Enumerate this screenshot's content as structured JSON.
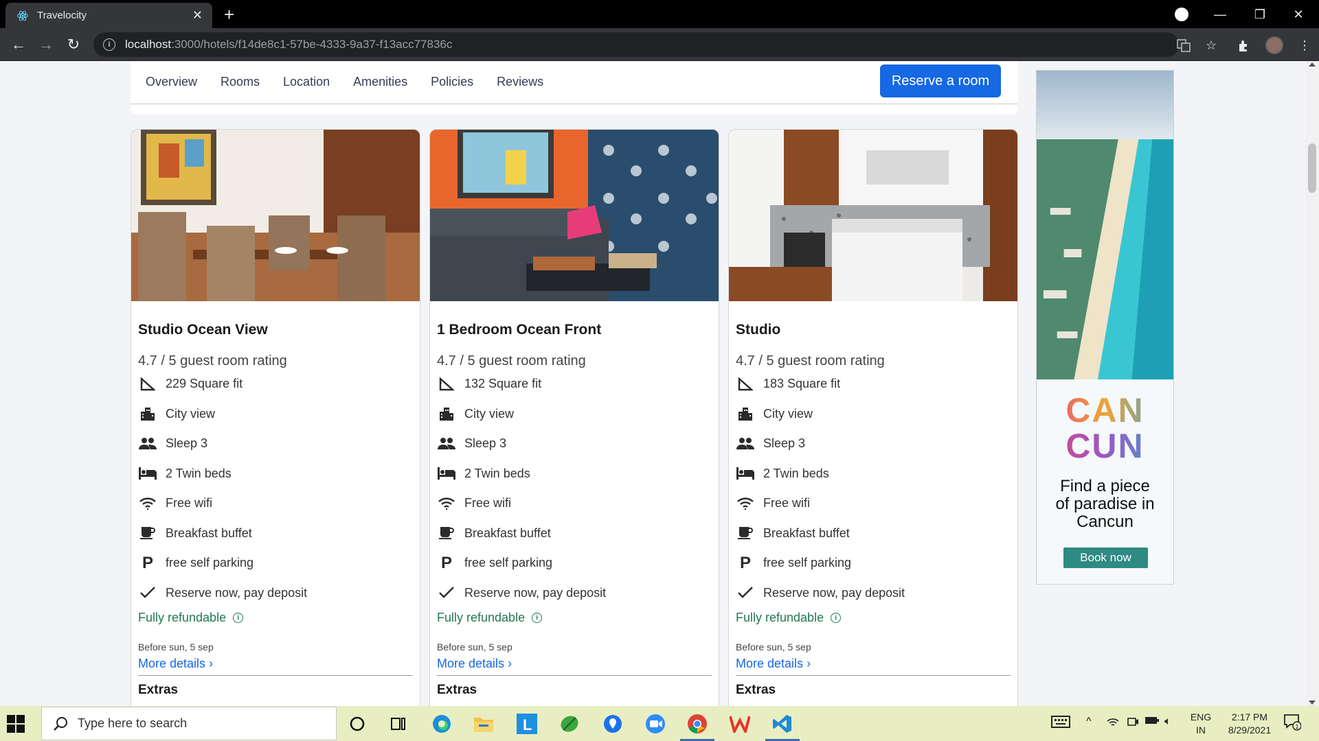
{
  "browser": {
    "tab_title": "Travelocity",
    "url_host": "localhost",
    "url_path": ":3000/hotels/f14de8c1-57be-4333-9a37-f13acc77836c"
  },
  "subnav": {
    "links": [
      "Overview",
      "Rooms",
      "Location",
      "Amenities",
      "Policies",
      "Reviews"
    ],
    "reserve_label": "Reserve a room"
  },
  "rooms": [
    {
      "name": "Studio Ocean View",
      "rating": "4.7 / 5 guest room rating",
      "features": [
        {
          "icon": "area-icon",
          "text": "229 Square fit"
        },
        {
          "icon": "city-icon",
          "text": "City view"
        },
        {
          "icon": "people-icon",
          "text": "Sleep 3"
        },
        {
          "icon": "bed-icon",
          "text": "2 Twin beds"
        },
        {
          "icon": "wifi-icon",
          "text": "Free wifi"
        },
        {
          "icon": "coffee-icon",
          "text": "Breakfast buffet"
        },
        {
          "icon": "parking-icon",
          "text": "free self parking"
        },
        {
          "icon": "check-icon",
          "text": "Reserve now, pay deposit"
        }
      ],
      "refund": "Fully refundable",
      "before": "Before sun, 5 sep",
      "more": "More details",
      "extras": "Extras"
    },
    {
      "name": "1 Bedroom Ocean Front",
      "rating": "4.7 / 5 guest room rating",
      "features": [
        {
          "icon": "area-icon",
          "text": "132 Square fit"
        },
        {
          "icon": "city-icon",
          "text": "City view"
        },
        {
          "icon": "people-icon",
          "text": "Sleep 3"
        },
        {
          "icon": "bed-icon",
          "text": "2 Twin beds"
        },
        {
          "icon": "wifi-icon",
          "text": "Free wifi"
        },
        {
          "icon": "coffee-icon",
          "text": "Breakfast buffet"
        },
        {
          "icon": "parking-icon",
          "text": "free self parking"
        },
        {
          "icon": "check-icon",
          "text": "Reserve now, pay deposit"
        }
      ],
      "refund": "Fully refundable",
      "before": "Before sun, 5 sep",
      "more": "More details",
      "extras": "Extras"
    },
    {
      "name": "Studio",
      "rating": "4.7 / 5 guest room rating",
      "features": [
        {
          "icon": "area-icon",
          "text": "183 Square fit"
        },
        {
          "icon": "city-icon",
          "text": "City view"
        },
        {
          "icon": "people-icon",
          "text": "Sleep 3"
        },
        {
          "icon": "bed-icon",
          "text": "2 Twin beds"
        },
        {
          "icon": "wifi-icon",
          "text": "Free wifi"
        },
        {
          "icon": "coffee-icon",
          "text": "Breakfast buffet"
        },
        {
          "icon": "parking-icon",
          "text": "free self parking"
        },
        {
          "icon": "check-icon",
          "text": "Reserve now, pay deposit"
        }
      ],
      "refund": "Fully refundable",
      "before": "Before sun, 5 sep",
      "more": "More details",
      "extras": "Extras"
    }
  ],
  "ad": {
    "line1": "CAN",
    "line2": "CUN",
    "tagline1": "Find a piece",
    "tagline2": "of paradise in",
    "tagline3": "Cancun",
    "button": "Book now"
  },
  "taskbar": {
    "search_placeholder": "Type here to search",
    "lang1": "ENG",
    "lang2": "IN",
    "time": "2:17 PM",
    "date": "8/29/2021",
    "notification_count": "1"
  },
  "colors": {
    "primary": "#1668e3",
    "refund_green": "#227950",
    "taskbar": "#e8eec2"
  }
}
